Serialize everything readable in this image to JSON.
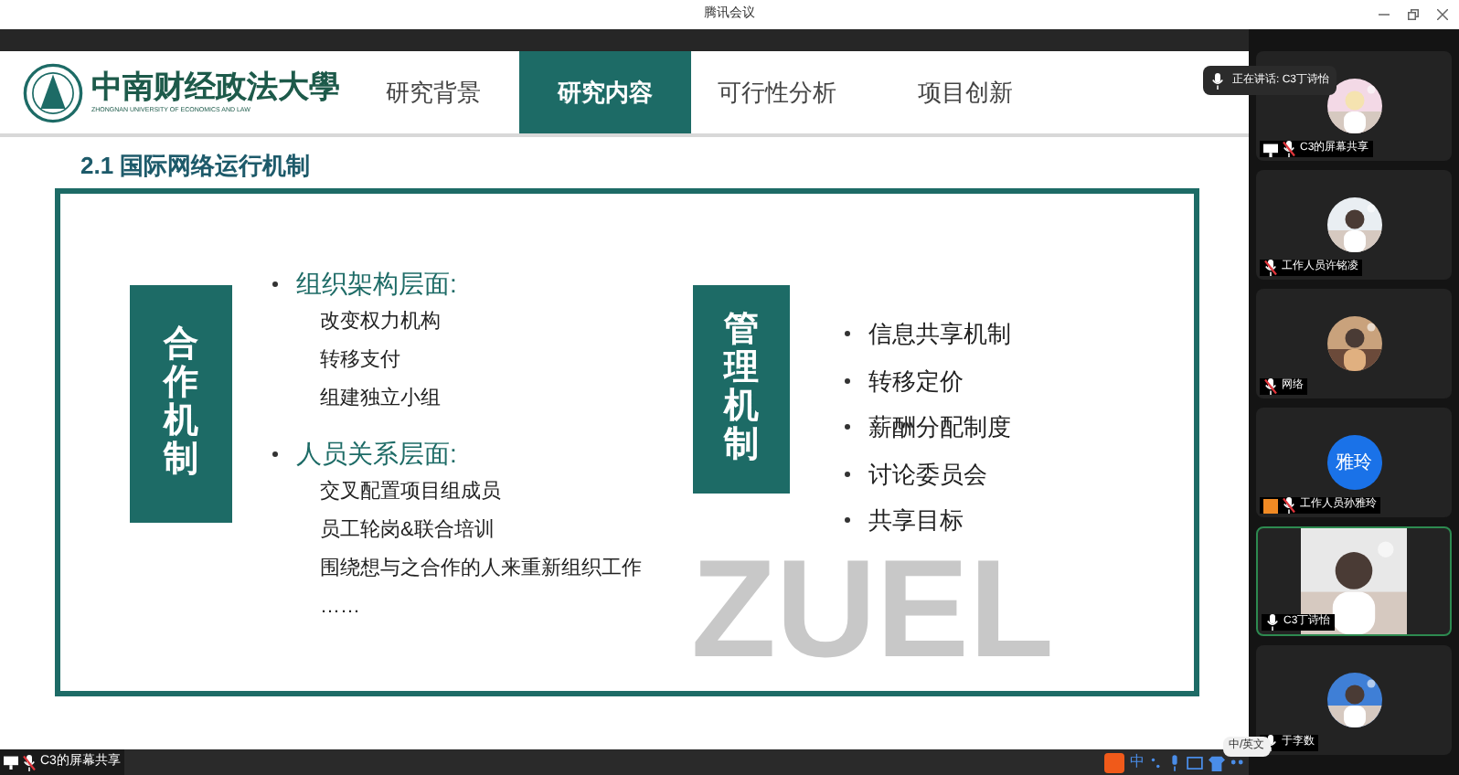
{
  "window": {
    "title": "腾讯会议"
  },
  "slide": {
    "logo": {
      "name": "中南财经政法大學",
      "subtitle": "ZHONGNAN UNIVERSITY OF ECONOMICS AND LAW"
    },
    "nav": [
      {
        "label": "研究背景",
        "selected": false
      },
      {
        "label": "研究内容",
        "selected": true
      },
      {
        "label": "可行性分析",
        "selected": false
      },
      {
        "label": "项目创新",
        "selected": false
      }
    ],
    "heading": "2.1 国际网络运行机制",
    "backdrop": "ZUEL",
    "left_label": "合作机制",
    "left_groups": [
      {
        "title": "组织架构层面:",
        "items": [
          "改变权力机构",
          "转移支付",
          "组建独立小组"
        ]
      },
      {
        "title": "人员关系层面:",
        "items": [
          "交叉配置项目组成员",
          "员工轮岗&联合培训",
          "围绕想与之合作的人来重新组织工作",
          "……"
        ]
      }
    ],
    "right_label": "管理机制",
    "right_items": [
      "信息共享机制",
      "转移定价",
      "薪酬分配制度",
      "讨论委员会",
      "共享目标"
    ]
  },
  "speaking": "正在讲话: C3丁诗怡",
  "participants": [
    {
      "name": "C3的屏幕共享",
      "kind": "avatar",
      "mic_muted": true,
      "sharing": true,
      "host": false
    },
    {
      "name": "工作人员许铭凌",
      "kind": "avatar",
      "mic_muted": true,
      "sharing": false,
      "host": false
    },
    {
      "name": "网络",
      "kind": "avatar",
      "mic_muted": true,
      "sharing": false,
      "host": false
    },
    {
      "name": "工作人员孙雅玲",
      "kind": "initials",
      "initials": "雅玲",
      "mic_muted": true,
      "sharing": false,
      "host": true
    },
    {
      "name": "C3丁诗怡",
      "kind": "video",
      "mic_muted": false,
      "sharing": false,
      "host": false
    },
    {
      "name": "于李数",
      "kind": "avatar",
      "mic_muted": false,
      "sharing": false,
      "host": false
    }
  ],
  "bottom_bar": {
    "share_label": "C3的屏幕共享",
    "ime_mode": "中",
    "ime_tooltip": "中/英文"
  }
}
